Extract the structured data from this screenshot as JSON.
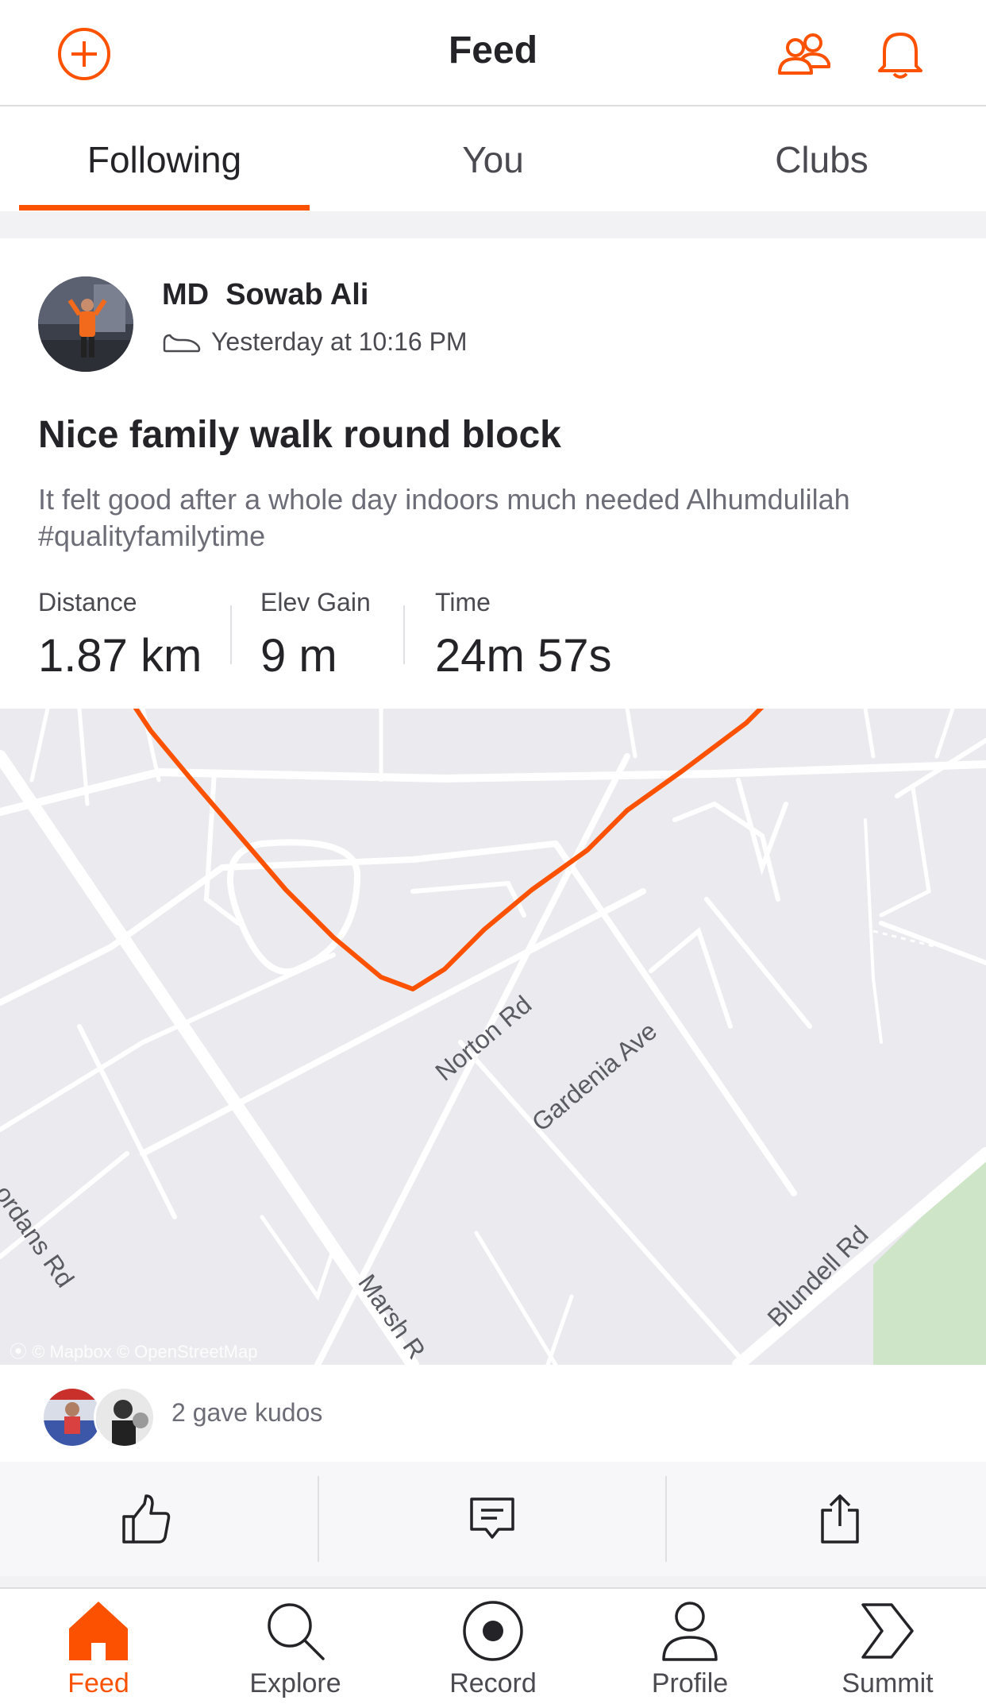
{
  "header": {
    "title": "Feed",
    "icons": [
      "add-circle-icon",
      "friends-icon",
      "bell-icon"
    ],
    "accent": "#fc5200"
  },
  "tabs": [
    {
      "label": "Following",
      "active": true
    },
    {
      "label": "You",
      "active": false
    },
    {
      "label": "Clubs",
      "active": false
    }
  ],
  "activity": {
    "athlete": "MD  Sowab Ali",
    "time": "Yesterday at 10:16 PM",
    "type_icon": "shoe-icon",
    "title": "Nice family walk round block",
    "description": "It felt good after a whole day indoors much needed Alhumdulilah #qualityfamilytime",
    "stats": [
      {
        "label": "Distance",
        "value": "1.87 km"
      },
      {
        "label": "Elev Gain",
        "value": "9 m"
      },
      {
        "label": "Time",
        "value": "24m 57s"
      }
    ]
  },
  "map": {
    "streets": [
      "Norton Rd",
      "Gardenia Ave",
      "Blundell Rd",
      "Marsh R",
      "ordans Rd"
    ],
    "attribution": "© Mapbox © OpenStreetMap",
    "route_color": "#fc5200"
  },
  "kudos": {
    "text": "2 gave kudos"
  },
  "actions": [
    "thumbs-up-icon",
    "comment-icon",
    "share-icon"
  ],
  "nav": [
    {
      "label": "Feed",
      "icon": "home-icon",
      "active": true
    },
    {
      "label": "Explore",
      "icon": "search-icon",
      "active": false
    },
    {
      "label": "Record",
      "icon": "record-icon",
      "active": false
    },
    {
      "label": "Profile",
      "icon": "profile-icon",
      "active": false
    },
    {
      "label": "Summit",
      "icon": "summit-icon",
      "active": false
    }
  ]
}
